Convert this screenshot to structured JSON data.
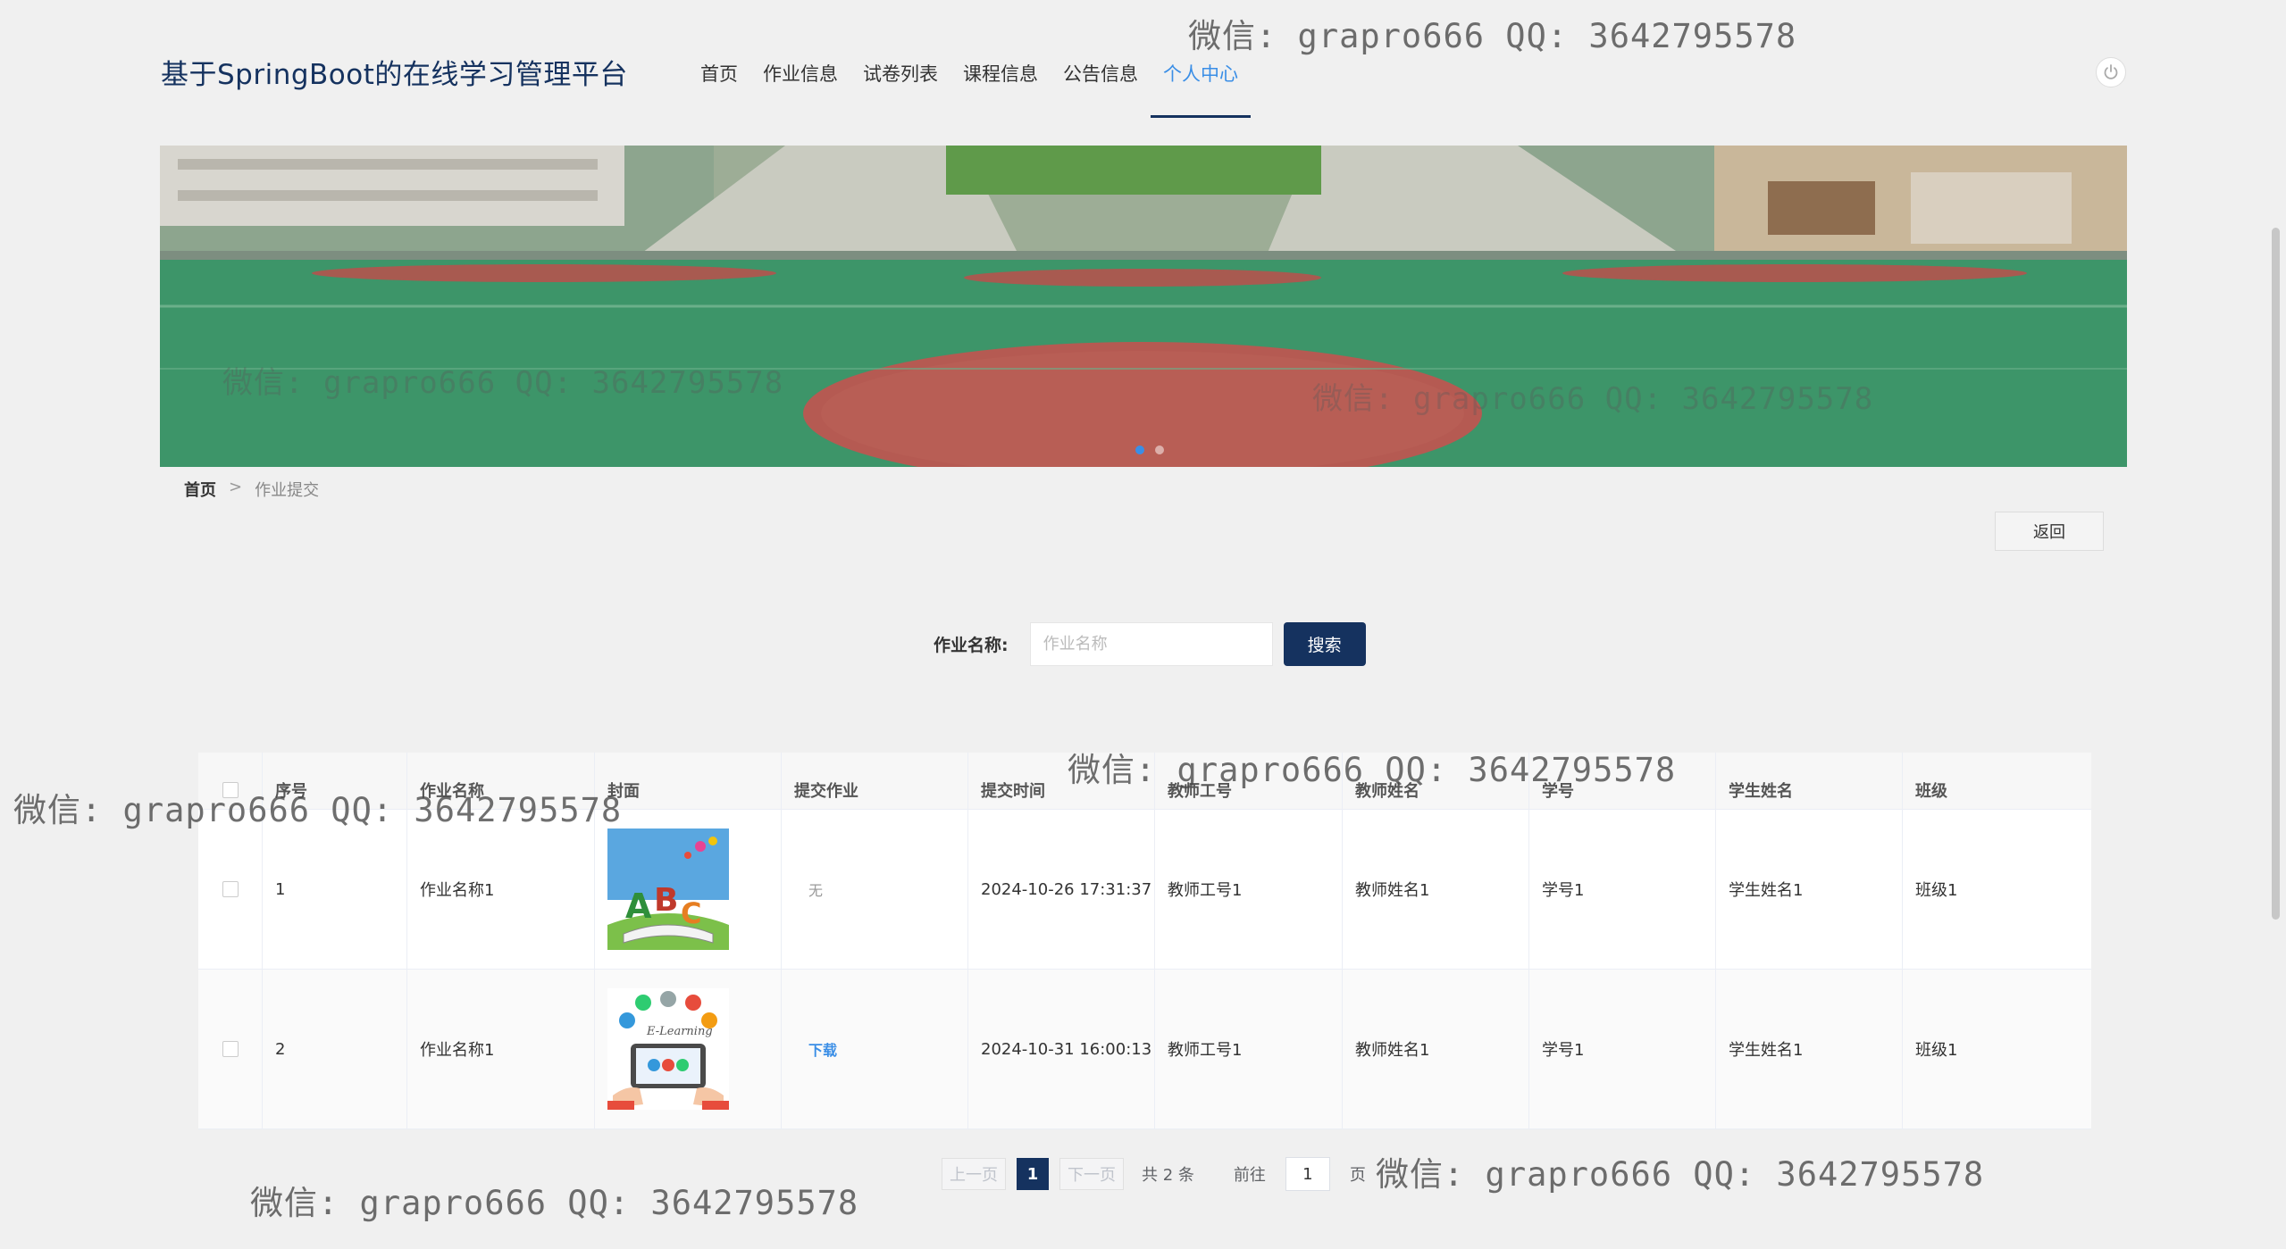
{
  "header": {
    "site_title": "基于SpringBoot的在线学习管理平台",
    "nav": [
      {
        "label": "首页"
      },
      {
        "label": "作业信息"
      },
      {
        "label": "试卷列表"
      },
      {
        "label": "课程信息"
      },
      {
        "label": "公告信息"
      },
      {
        "label": "个人中心",
        "active": true
      }
    ],
    "power_icon": "power-icon"
  },
  "breadcrumb": {
    "home": "首页",
    "separator": ">",
    "current": "作业提交"
  },
  "back_button": "返回",
  "search": {
    "label": "作业名称:",
    "placeholder": "作业名称",
    "button": "搜索"
  },
  "table": {
    "headers": [
      "序号",
      "作业名称",
      "封面",
      "提交作业",
      "提交时间",
      "教师工号",
      "教师姓名",
      "学号",
      "学生姓名",
      "班级"
    ],
    "rows": [
      {
        "index": "1",
        "name": "作业名称1",
        "cover": "abc-book-image",
        "submission": "无",
        "submitted": false,
        "time": "2024-10-26 17:31:37",
        "teacher_id": "教师工号1",
        "teacher_name": "教师姓名1",
        "student_id": "学号1",
        "student_name": "学生姓名1",
        "class": "班级1"
      },
      {
        "index": "2",
        "name": "作业名称1",
        "cover": "e-learning-tablet-image",
        "submission": "下载",
        "submitted": true,
        "time": "2024-10-31 16:00:13",
        "teacher_id": "教师工号1",
        "teacher_name": "教师姓名1",
        "student_id": "学号1",
        "student_name": "学生姓名1",
        "class": "班级1"
      }
    ]
  },
  "pagination": {
    "prev": "上一页",
    "current_page": "1",
    "next": "下一页",
    "total": "共 2 条",
    "goto_label": "前往",
    "goto_value": "1",
    "page_suffix": "页"
  },
  "watermarks": {
    "w1": "微信: grapro666 QQ: 3642795578",
    "w2": "微信: grapro666 QQ: 3642795578",
    "w3": "微信: grapro666 QQ: 3642795578",
    "w4": "微信: grapro666 QQ: 3642795578",
    "w5": "微信: grapro666 QQ: 3642795578",
    "banner_wm1": "微信: grapro666 QQ: 3642795578",
    "banner_wm2": "微信: grapro666 QQ: 3642795578"
  },
  "colors": {
    "primary": "#15325f",
    "accent": "#3a8ee6",
    "background": "#f0f0f0"
  }
}
